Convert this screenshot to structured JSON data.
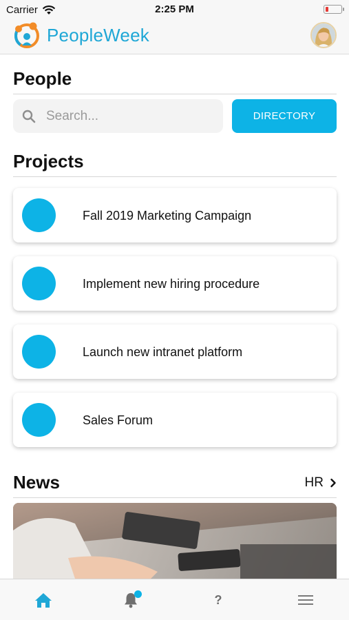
{
  "status_bar": {
    "carrier": "Carrier",
    "time": "2:25 PM"
  },
  "header": {
    "app_name": "PeopleWeek"
  },
  "people": {
    "title": "People",
    "search_placeholder": "Search...",
    "directory_label": "DIRECTORY"
  },
  "projects": {
    "title": "Projects",
    "items": [
      {
        "name": "Fall 2019 Marketing Campaign"
      },
      {
        "name": "Implement new hiring procedure"
      },
      {
        "name": "Launch new intranet platform"
      },
      {
        "name": "Sales Forum"
      }
    ]
  },
  "news": {
    "title": "News",
    "link_label": "HR"
  },
  "tab_bar": {
    "help_label": "?",
    "items": [
      {
        "icon": "home-icon",
        "active": true
      },
      {
        "icon": "bell-icon",
        "badge": true
      },
      {
        "icon": "help-icon"
      },
      {
        "icon": "menu-icon"
      }
    ]
  },
  "colors": {
    "accent": "#0db3e6",
    "brand_text": "#1fa7d6",
    "battery_low": "#e53935"
  }
}
